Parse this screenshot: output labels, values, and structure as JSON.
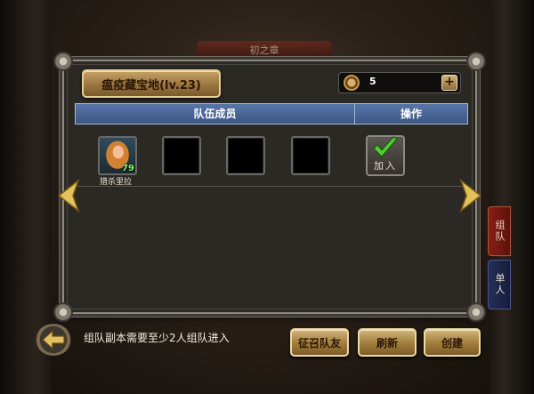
{
  "background": {
    "banner_title": "初之章",
    "side_tabs": [
      "组队",
      "单人"
    ]
  },
  "panel": {
    "dungeon_title": "瘟疫藏宝地(lv.23)",
    "currency_value": "5",
    "plus_label": "+",
    "header": {
      "members": "队伍成员",
      "action": "操作"
    },
    "members": [
      {
        "name": "猎杀里拉",
        "level": "79",
        "filled": true
      },
      {
        "name": "",
        "level": "",
        "filled": false
      },
      {
        "name": "",
        "level": "",
        "filled": false
      },
      {
        "name": "",
        "level": "",
        "filled": false
      }
    ],
    "join_label": "加入"
  },
  "bottom": {
    "hint": "组队副本需要至少2人组队进入",
    "buttons": {
      "recruit": "征召队友",
      "refresh": "刷新",
      "create": "创建"
    }
  },
  "colors": {
    "header_bg": "#4a67a0",
    "button_gold": "#b9944e",
    "level_green": "#7cff5a",
    "check_green": "#4fd12f"
  },
  "icons": {
    "currency": "compass-icon",
    "join": "check-icon",
    "back": "back-arrow-icon",
    "nav_left": "chevron-left-icon",
    "nav_right": "chevron-right-icon"
  }
}
